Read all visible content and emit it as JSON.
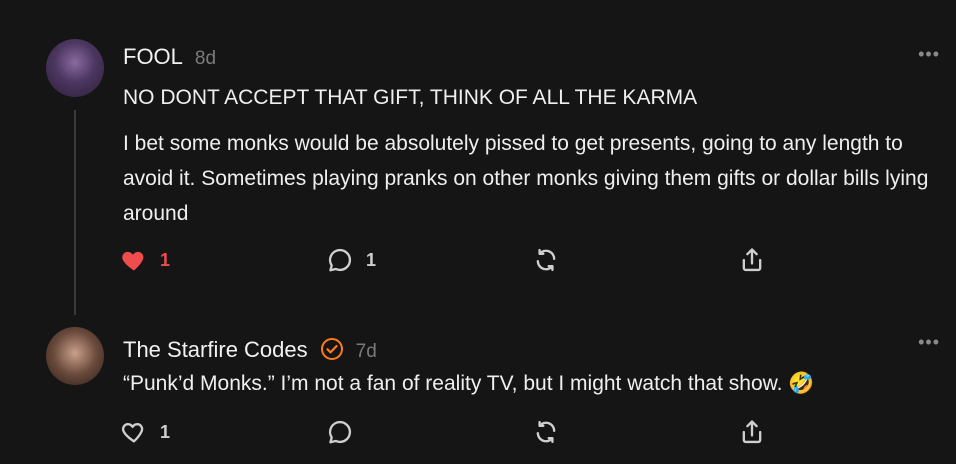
{
  "comments": [
    {
      "author": "FOOL",
      "time": "8d",
      "more": "•••",
      "title": "NO DONT ACCEPT THAT GIFT, THINK OF ALL THE KARMA",
      "text": "I bet some monks would be absolutely pissed to get presents, going to any length to avoid it. Sometimes playing pranks on other monks giving them gifts or dollar bills lying around",
      "likes": "1",
      "liked": true,
      "replies": "1"
    },
    {
      "author": "The Starfire Codes",
      "verified": true,
      "time": "7d",
      "more": "•••",
      "text": "“Punk’d Monks.” I’m not a fan of reality TV, but I might watch that show. 🤣",
      "likes": "1",
      "liked": false,
      "replies": ""
    }
  ],
  "colors": {
    "accent_like": "#ef4d4d",
    "verified": "#ff7a1a",
    "background": "#151515"
  }
}
